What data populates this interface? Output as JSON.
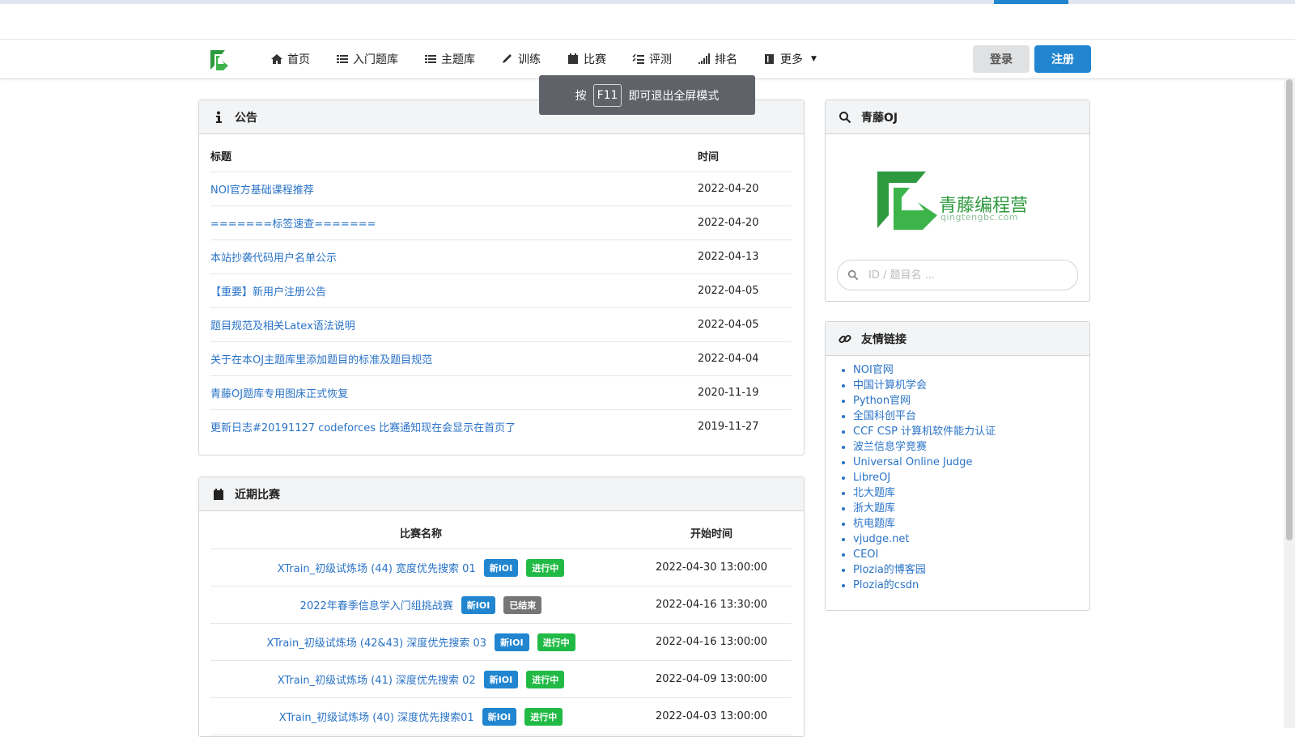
{
  "nav": {
    "items": [
      {
        "label": "首页",
        "icon": "home-icon"
      },
      {
        "label": "入门题库",
        "icon": "list-icon"
      },
      {
        "label": "主题库",
        "icon": "list-icon"
      },
      {
        "label": "训练",
        "icon": "pencil-icon"
      },
      {
        "label": "比赛",
        "icon": "calendar-icon"
      },
      {
        "label": "评测",
        "icon": "tasks-icon"
      },
      {
        "label": "排名",
        "icon": "signal-icon"
      },
      {
        "label": "更多",
        "icon": "book-icon"
      }
    ],
    "login": "登录",
    "register": "注册"
  },
  "toast": {
    "prefix": "按",
    "key": "F11",
    "suffix": "即可退出全屏模式"
  },
  "announcements": {
    "title": "公告",
    "col_title": "标题",
    "col_time": "时间",
    "rows": [
      {
        "title": "NOI官方基础课程推荐",
        "date": "2022-04-20"
      },
      {
        "title": "=======标签速查=======",
        "date": "2022-04-20"
      },
      {
        "title": "本站抄袭代码用户名单公示",
        "date": "2022-04-13"
      },
      {
        "title": "【重要】新用户注册公告",
        "date": "2022-04-05"
      },
      {
        "title": "题目规范及相关Latex语法说明",
        "date": "2022-04-05"
      },
      {
        "title": "关于在本OJ主题库里添加题目的标准及题目规范",
        "date": "2022-04-04"
      },
      {
        "title": "青藤OJ题库专用图床正式恢复",
        "date": "2020-11-19"
      },
      {
        "title": "更新日志#20191127 codeforces 比赛通知现在会显示在首页了",
        "date": "2019-11-27"
      }
    ]
  },
  "contests": {
    "title": "近期比赛",
    "col_name": "比赛名称",
    "col_start": "开始时间",
    "rows": [
      {
        "name": "XTrain_初级试炼场 (44) 宽度优先搜索 01",
        "tag": "新IOI",
        "status": "进行中",
        "status_color": "#21ba45",
        "start": "2022-04-30 13:00:00"
      },
      {
        "name": "2022年春季信息学入门组挑战赛",
        "tag": "新IOI",
        "status": "已结束",
        "status_color": "#767676",
        "start": "2022-04-16 13:30:00"
      },
      {
        "name": "XTrain_初级试炼场 (42&43) 深度优先搜索 03",
        "tag": "新IOI",
        "status": "进行中",
        "status_color": "#21ba45",
        "start": "2022-04-16 13:00:00"
      },
      {
        "name": "XTrain_初级试炼场 (41) 深度优先搜索 02",
        "tag": "新IOI",
        "status": "进行中",
        "status_color": "#21ba45",
        "start": "2022-04-09 13:00:00"
      },
      {
        "name": "XTrain_初级试炼场 (40) 深度优先搜索01",
        "tag": "新IOI",
        "status": "进行中",
        "status_color": "#21ba45",
        "start": "2022-04-03 13:00:00"
      }
    ]
  },
  "oj_panel": {
    "title": "青藤OJ",
    "brand_name": "青藤编程营",
    "brand_url": "qingtengbc.com",
    "search_placeholder": "ID / 题目名 ..."
  },
  "friend_links": {
    "title": "友情链接",
    "items": [
      "NOI官网",
      "中国计算机学会",
      "Python官网",
      "全国科创平台",
      "CCF CSP 计算机软件能力认证",
      "波兰信息学竞赛",
      "Universal Online Judge",
      "LibreOJ",
      "北大题库",
      "浙大题库",
      "杭电题库",
      "vjudge.net",
      "CEOI",
      "Plozia的博客园",
      "Plozia的csdn"
    ]
  },
  "colors": {
    "primary": "#2185d0",
    "green": "#21ba45",
    "grey": "#767676",
    "link": "#2a73c7",
    "brand": "#2e9a3f"
  }
}
